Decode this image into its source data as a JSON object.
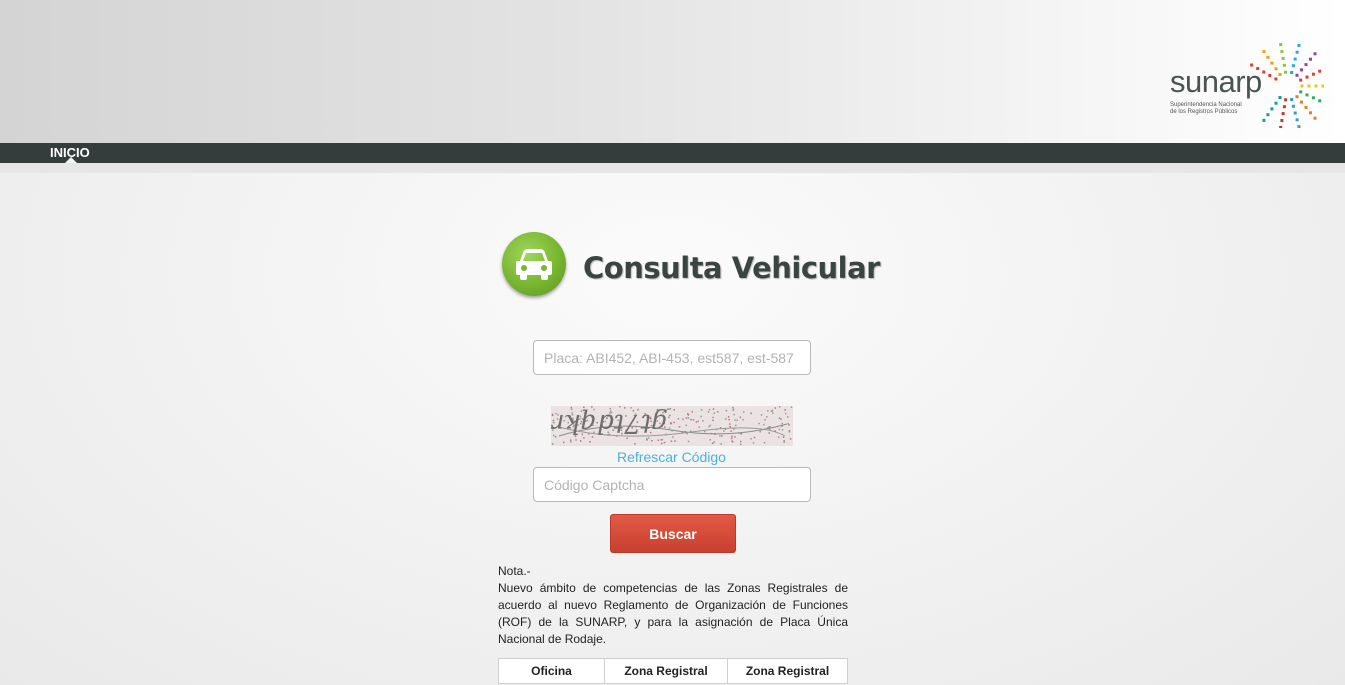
{
  "header": {
    "logo": {
      "word": "sunarp",
      "tagline_line1": "Superintendencia Nacional",
      "tagline_line2": "de los Registros Públicos"
    }
  },
  "nav": {
    "inicio": "INICIO"
  },
  "main": {
    "title": "Consulta Vehicular",
    "placa_placeholder": "Placa: ABI452, ABI-453, est587, est-587",
    "captcha_text": "gt7tdqkr",
    "refresh_label": "Refrescar Código",
    "captcha_placeholder": "Código Captcha",
    "search_button": "Buscar",
    "nota_title": "Nota.-",
    "nota_body": "Nuevo ámbito de competencias de las Zonas Registrales de acuerdo al nuevo Reglamento de Organización de Funciones (ROF) de la SUNARP, y para la asignación de Placa Única Nacional de Rodaje.",
    "table_headers": [
      "Oficina",
      "Zona Registral",
      "Zona Registral"
    ]
  },
  "colors": {
    "accent_green": "#78b530",
    "button_red": "#d44a37",
    "link_blue": "#4cb0d8",
    "nav_dark": "#343d3b"
  },
  "icons": [
    "car-icon",
    "sunarp-burst-icon"
  ]
}
